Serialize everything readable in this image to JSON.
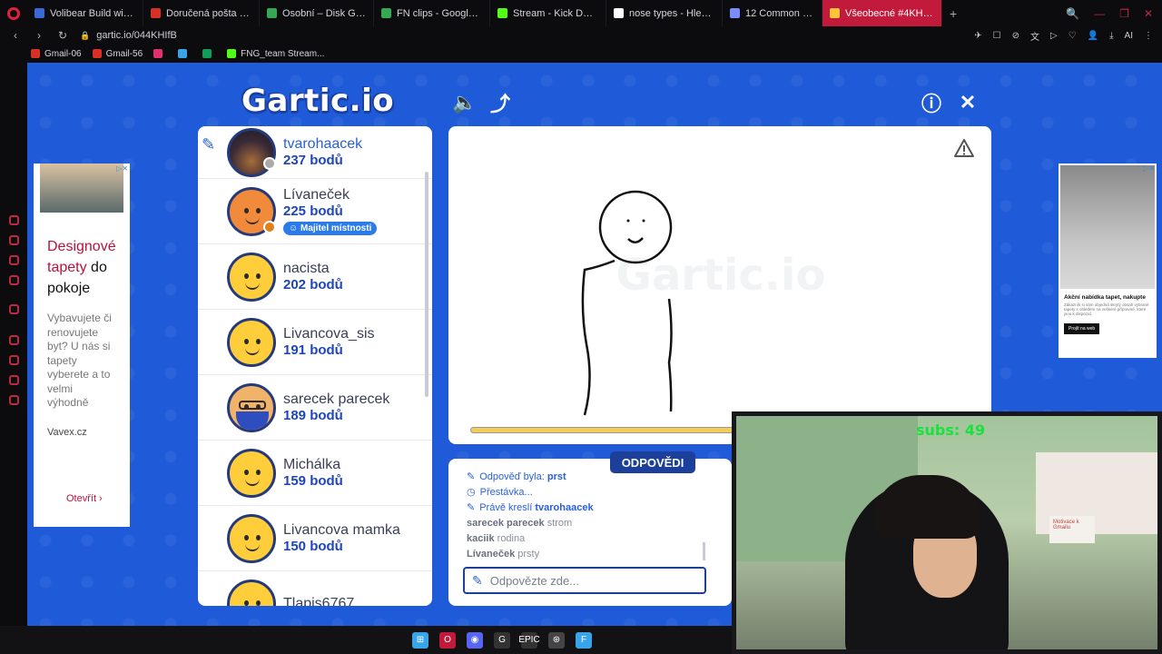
{
  "browser": {
    "tabs": [
      {
        "label": "Volibear Build with Highest",
        "color": "#3a6ad8"
      },
      {
        "label": "Doručená pošta (1 860) - ",
        "color": "#d93025"
      },
      {
        "label": "Osobní – Disk Google",
        "color": "#34a853"
      },
      {
        "label": "FN clips - Google Drive",
        "color": "#34a853"
      },
      {
        "label": "Stream - Kick Dashboard",
        "color": "#53fc18"
      },
      {
        "label": "nose types - Hledat Goog",
        "color": "#ffffff"
      },
      {
        "label": "12 Common Nose Shapes",
        "color": "#7a8cff"
      },
      {
        "label": "Všeobecné #4KHIfB (Češt",
        "color": "#ffc43a"
      }
    ],
    "url": "gartic.io/044KHIfB",
    "bookmarks": [
      {
        "label": "Gmail-06",
        "color": "#d93025"
      },
      {
        "label": "Gmail-56",
        "color": "#d93025"
      },
      {
        "label": "",
        "color": "#e1306c"
      },
      {
        "label": "",
        "color": "#3aa4e8"
      },
      {
        "label": "",
        "color": "#0f9d58"
      },
      {
        "label": "FNG_team Stream...",
        "color": "#53fc18"
      }
    ],
    "addr_right": [
      "✈",
      "☐",
      "⊘",
      "文",
      "▷",
      "♡",
      "👤",
      "⤓",
      "AI",
      "⋮"
    ],
    "win_controls": [
      "🔍",
      "—",
      "❐",
      "✕"
    ]
  },
  "game": {
    "logo": "Gartic.io",
    "icons": {
      "sound": "🔈",
      "share": "⤴",
      "info": "ⓘ",
      "close": "✕"
    },
    "players": [
      {
        "name": "tvarohaacek",
        "score": "237 bodů",
        "avatar": "photo",
        "me": true,
        "dot": "#aaaaaa"
      },
      {
        "name": "Lívaneček",
        "score": "225 bodů",
        "avatar": "orange",
        "badge": "Majitel místnosti",
        "dot": "#e0801a"
      },
      {
        "name": "nacista",
        "score": "202 bodů",
        "avatar": "default"
      },
      {
        "name": "Livancova_sis",
        "score": "191 bodů",
        "avatar": "default"
      },
      {
        "name": "sarecek parecek",
        "score": "189 bodů",
        "avatar": "bearded"
      },
      {
        "name": "Michálka",
        "score": "159 bodů",
        "avatar": "default"
      },
      {
        "name": "Livancova mamka",
        "score": "150 bodů",
        "avatar": "default"
      },
      {
        "name": "Tlapis6767",
        "score": "",
        "avatar": "default"
      }
    ],
    "answers": {
      "tab": "ODPOVĚDI",
      "log": [
        {
          "type": "sys",
          "icon": "✎",
          "text": "Odpověď byla: ",
          "bold": "prst"
        },
        {
          "type": "sys",
          "icon": "◷",
          "text": "Přestávka...",
          "bold": ""
        },
        {
          "type": "sys",
          "icon": "✎",
          "text": "Právě kreslí ",
          "bold": "tvarohaacek"
        },
        {
          "type": "guess",
          "user": "sarecek parecek",
          "text": "strom"
        },
        {
          "type": "guess",
          "user": "kaciik",
          "text": "rodina"
        },
        {
          "type": "guess",
          "user": "Lívaneček",
          "text": "prsty"
        }
      ],
      "placeholder": "Odpovězte zde..."
    },
    "timer_progress": 0.5
  },
  "ads": {
    "left": {
      "heading_accent_1": "Designové",
      "heading_accent_2": "tapety",
      "heading_rest_1": " do",
      "heading_rest_2": "pokoje",
      "body": "Vybavujete či renovujete byt? U nás si tapety vyberete a to velmi výhodně",
      "source": "Vavex.cz",
      "cta": "Otevřít ›"
    },
    "right": {
      "heading": "Akční nabídka tapet, nakupte",
      "text": "Zákazník si sám objedná skrytý obsah vybrané tapety s ohledem na veškeré přípravné, které jsou k dispozici.",
      "button": "Projít na web"
    }
  },
  "webcam": {
    "overlay": "subs: 49",
    "note": "Motivace k Gmailu"
  },
  "taskbar": [
    {
      "color": "#3aa4e8",
      "label": "⊞"
    },
    {
      "color": "#c21a3b",
      "label": "O"
    },
    {
      "color": "#5865f2",
      "label": "◉"
    },
    {
      "color": "#333333",
      "label": "G"
    },
    {
      "color": "#333333",
      "label": "EPIC"
    },
    {
      "color": "#444444",
      "label": "⊛"
    },
    {
      "color": "#3aa4e8",
      "label": "F"
    }
  ]
}
